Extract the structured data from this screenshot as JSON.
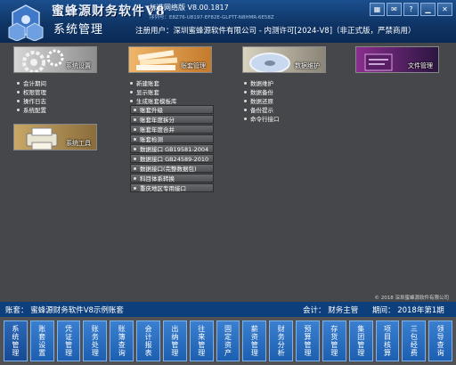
{
  "header": {
    "brand": "蜜蜂源财务软件V8",
    "version": "标准网络版  V8.00.1817",
    "serial": "序列号：E8Z76-U8197-EF82E-GLPTT-N8HMR-6E58Z",
    "module_title": "系统管理",
    "reg_user": "注册用户：深圳蜜蜂源软件有限公司 - 内测许可[2024-V8]（非正式版，严禁商用）",
    "window_buttons": [
      "grid-icon",
      "mail-icon",
      "help-icon",
      "minimize-icon",
      "close-icon"
    ]
  },
  "modules": [
    {
      "label": "系统设置",
      "items": [
        "会计期间",
        "权限管理",
        "操作日志",
        "系统配置"
      ]
    },
    {
      "label": "账套管理",
      "items": [
        "新建账套",
        "显示账套",
        "生成账套模板库",
        "账套升级",
        "账套年度拆分",
        "账套年度合并",
        "账套检测",
        "数据接口 GB19581-2004",
        "数据接口 GB24589-2010",
        "数据接口(完整数据包)",
        "科目体系转换",
        "重庆地区专用接口"
      ]
    },
    {
      "label": "数据维护",
      "items": [
        "数据维护",
        "数据备份",
        "数据还原",
        "备份提示",
        "命令行接口"
      ]
    },
    {
      "label": "文件管理",
      "items": []
    },
    {
      "label": "系统工具",
      "items": []
    }
  ],
  "copyright": "© 2018 深圳蜜蜂源软件有限公司",
  "status": {
    "account": "账套：  蜜蜂源财务软件V8示例账套",
    "accountant": "会计：  财务主管",
    "period": "期间：  2018年第1期"
  },
  "nav": [
    "系统管理",
    "账套设置",
    "凭证管理",
    "账务处理",
    "账簿查询",
    "会计报表",
    "出纳管理",
    "往来管理",
    "固定资产",
    "薪资管理",
    "财务分析",
    "预算管理",
    "存货管理",
    "集团管理",
    "项目核算",
    "三包经费",
    "领导查询"
  ],
  "colors": {
    "header": "#0f3566",
    "status": "#0d3f7d",
    "nav_button": "#2a70c4",
    "background": "#45474a"
  }
}
